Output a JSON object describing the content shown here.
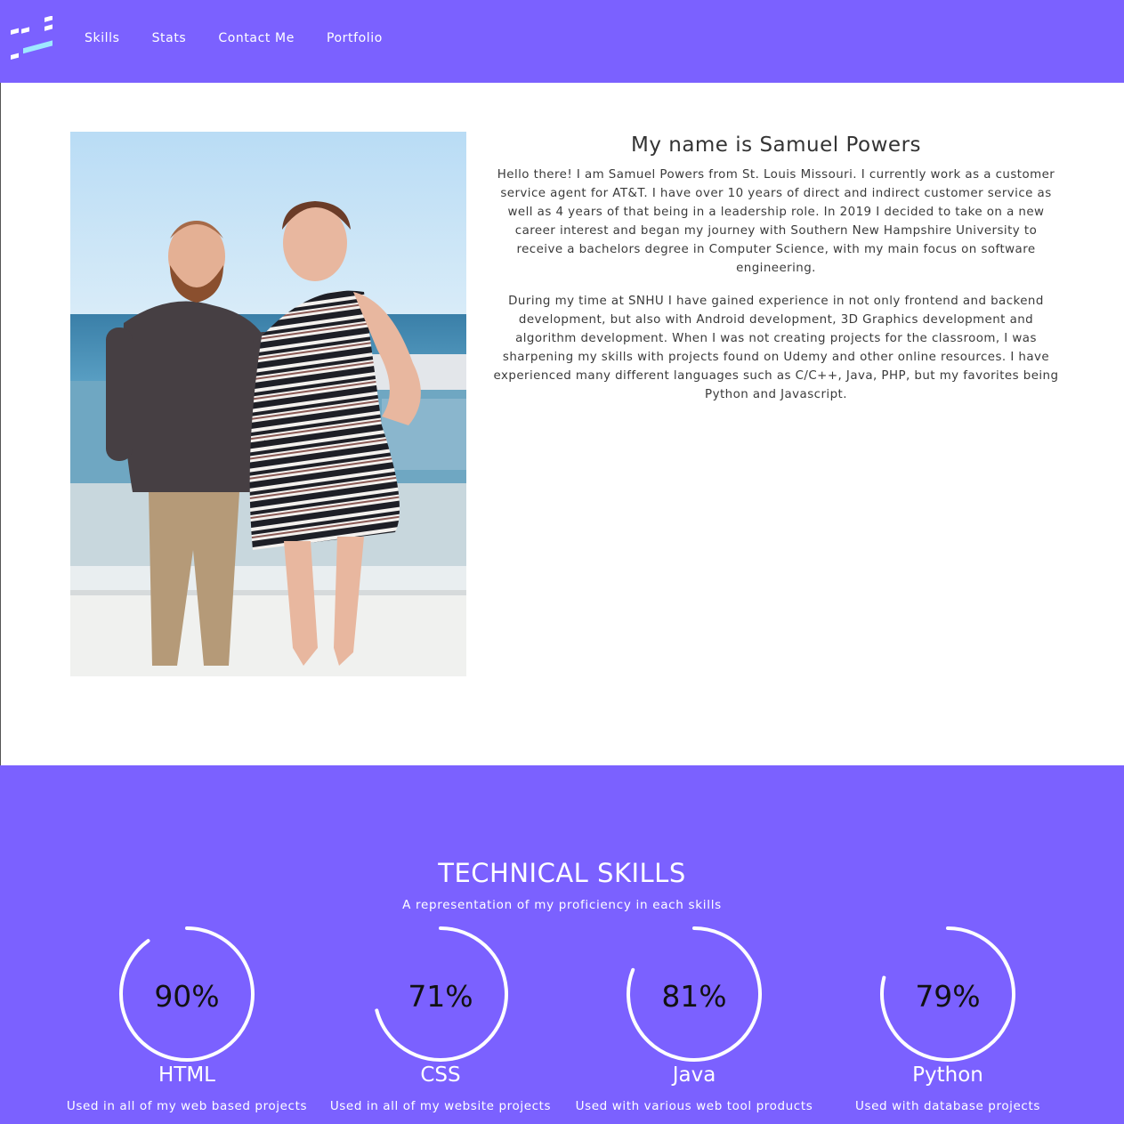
{
  "nav": {
    "logo": "logo-icon",
    "links": [
      "Skills",
      "Stats",
      "Contact Me",
      "Portfolio"
    ]
  },
  "about": {
    "photo": "photo of two people on a rooftop by the sea",
    "title": "My name is Samuel Powers",
    "paragraphs": [
      "Hello there! I am Samuel Powers from St. Louis Missouri. I currently work as a customer service agent for AT&T. I have over 10 years of direct and indirect customer service as well as 4 years of that being in a leadership role. In 2019 I decided to take on a new career interest and began my journey with Southern New Hampshire University to receive a bachelors degree in Computer Science, with my main focus on software engineering.",
      "During my time at SNHU I have gained experience in not only frontend and backend development, but also with Android development, 3D Graphics development and algorithm development. When I was not creating projects for the classroom, I was sharpening my skills with projects found on Udemy and other online resources. I have experienced many different languages such as C/C++, Java, PHP, but my favorites being Python and Javascript."
    ]
  },
  "skills": {
    "title": "TECHNICAL SKILLS",
    "subtitle": "A representation of my proficiency in each skills",
    "items": [
      {
        "percent_label": "90%",
        "percent": 90,
        "name": "HTML",
        "desc": "Used in all of my web based projects"
      },
      {
        "percent_label": "71%",
        "percent": 71,
        "name": "CSS",
        "desc": "Used in all of my website projects"
      },
      {
        "percent_label": "81%",
        "percent": 81,
        "name": "Java",
        "desc": "Used with various web tool products"
      },
      {
        "percent_label": "79%",
        "percent": 79,
        "name": "Python",
        "desc": "Used with database projects"
      }
    ]
  },
  "colors": {
    "accent": "#7b61ff",
    "ring": "#ffffff",
    "logo_light": "#9ee9ff",
    "logo_white": "#ffffff"
  }
}
